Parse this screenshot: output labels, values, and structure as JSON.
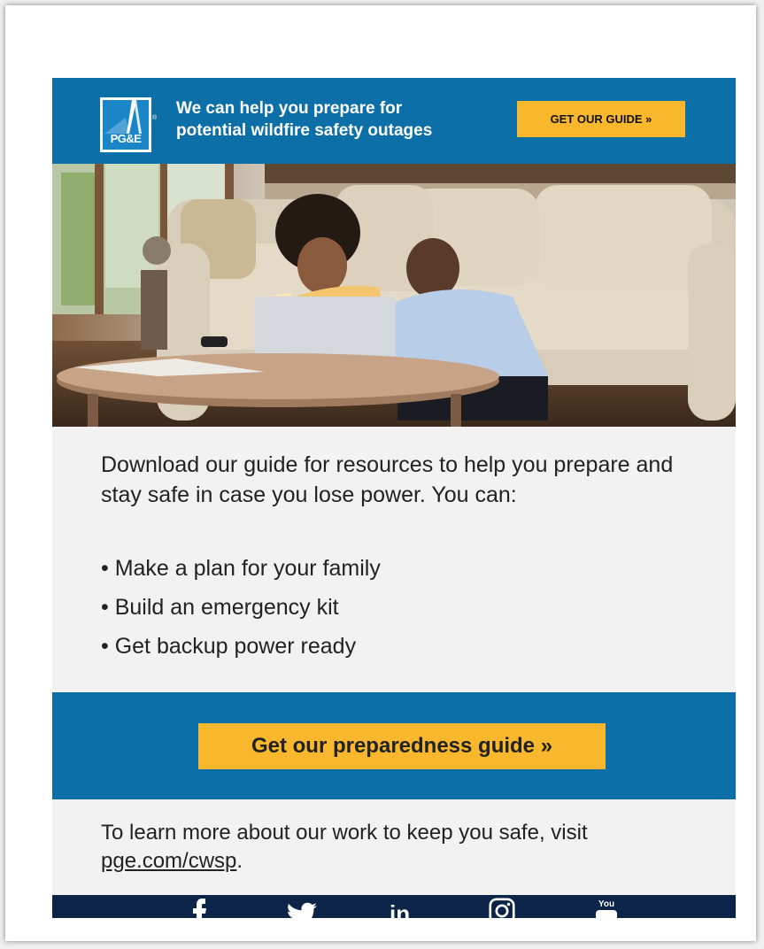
{
  "header": {
    "logo_text": "PG&E",
    "logo_reg": "®",
    "tagline_line1": "We can help you prepare for",
    "tagline_line2": "potential wildfire safety outages",
    "cta_label": "GET OUR GUIDE  »"
  },
  "hero": {
    "icon": "photo-couple-laptop-living-room"
  },
  "body": {
    "intro": "Download our guide for resources to help you prepare and stay safe in case you lose power. You can:",
    "bullets": [
      "• Make a plan for your family",
      "• Build an emergency kit",
      "• Get backup power ready"
    ]
  },
  "cta": {
    "label": "Get our preparedness guide »"
  },
  "learn_more": {
    "text_before": "To learn more about our work to keep you safe, visit ",
    "link": "pge.com/cwsp",
    "text_after": "."
  },
  "social": {
    "icons": [
      "facebook-icon",
      "twitter-icon",
      "linkedin-icon",
      "instagram-icon",
      "youtube-icon"
    ],
    "youtube_text": "You"
  },
  "colors": {
    "brand_blue": "#0d6fa8",
    "button_yellow": "#f8b72c",
    "footer_navy": "#0b2447",
    "body_gray": "#f2f2f2"
  }
}
